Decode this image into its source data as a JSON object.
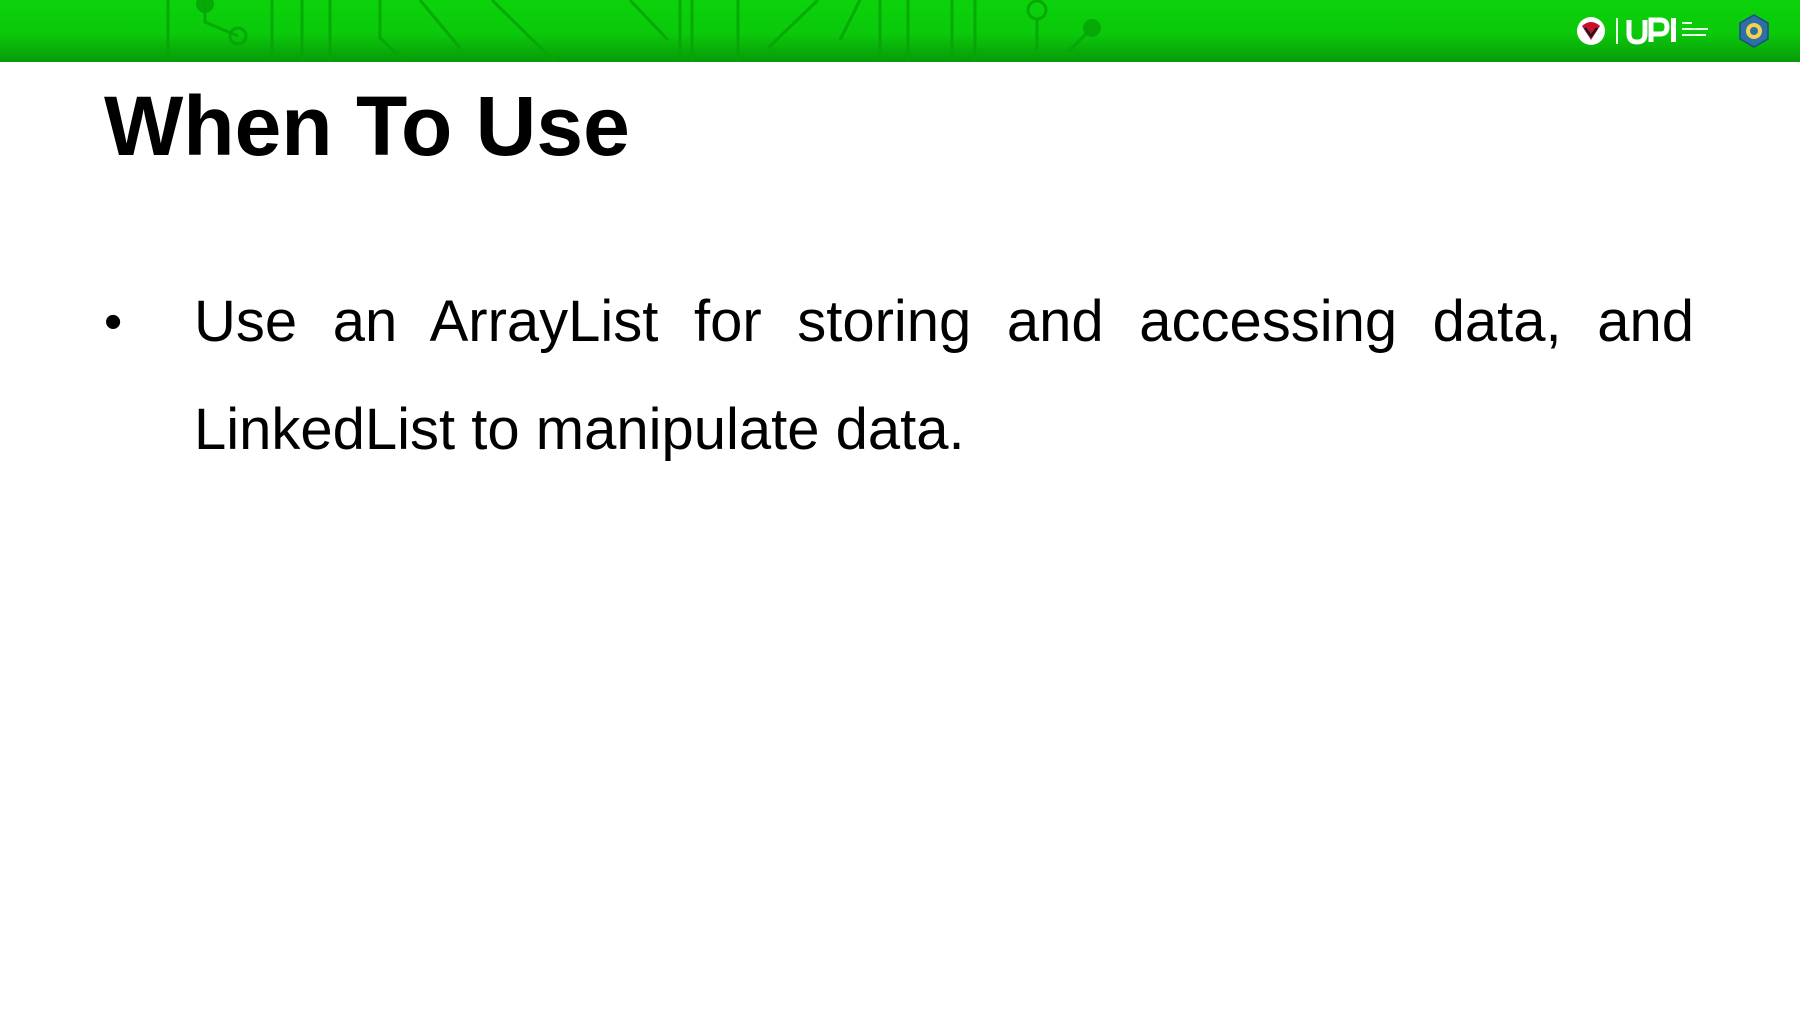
{
  "header": {
    "brand_color": "#0bcf0b",
    "logo_icon": "upi-logo-mark",
    "seal_icon": "university-seal-icon"
  },
  "slide": {
    "title": "When To Use",
    "bullets": [
      {
        "marker": "•",
        "text": "Use an ArrayList for storing and accessing data, and LinkedList to manipulate data."
      }
    ]
  }
}
